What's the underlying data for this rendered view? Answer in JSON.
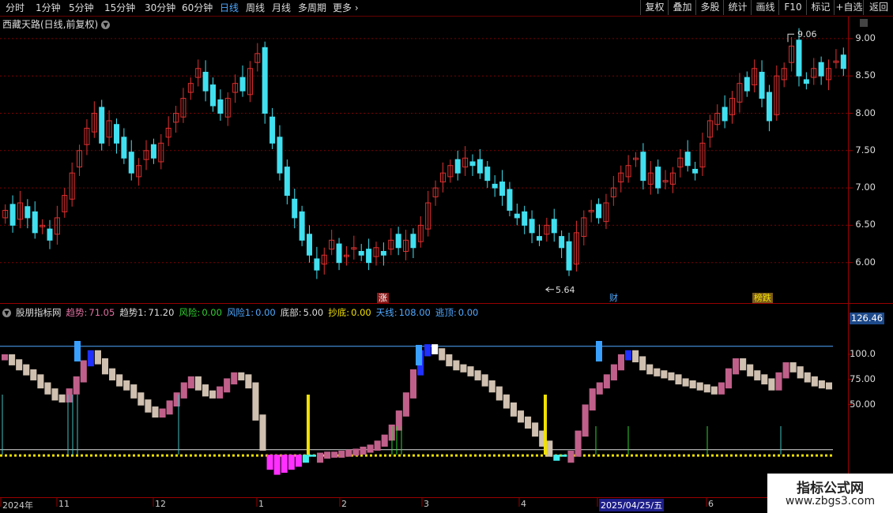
{
  "toolbar": {
    "periods": [
      "分时",
      "1分钟",
      "5分钟",
      "15分钟",
      "30分钟",
      "60分钟",
      "日线",
      "周线",
      "月线",
      "多周期",
      "更多"
    ],
    "active_period": "日线",
    "right_buttons": [
      "复权",
      "叠加",
      "多股",
      "统计",
      "画线",
      "F10",
      "标记",
      "+自选",
      "返回"
    ]
  },
  "main_chart": {
    "title": "西藏天路(日线,前复权)",
    "price_axis": [
      "9.00",
      "8.50",
      "8.00",
      "7.50",
      "7.00",
      "6.50",
      "6.00"
    ],
    "high_marker": "9.06",
    "low_marker": "5.64",
    "events": [
      "涨",
      "财",
      "榜跌"
    ]
  },
  "indicator": {
    "name": "股朋指标网",
    "fields": [
      {
        "label": "趋势:",
        "value": "71.05",
        "color": "#e070a0"
      },
      {
        "label": "趋势1:",
        "value": "71.20",
        "color": "#dddddd"
      },
      {
        "label": "风险:",
        "value": "0.00",
        "color": "#30d030"
      },
      {
        "label": "风险1:",
        "value": "0.00",
        "color": "#4fa8ff"
      },
      {
        "label": "底部:",
        "value": "5.00",
        "color": "#dddddd"
      },
      {
        "label": "抄底:",
        "value": "0.00",
        "color": "#f0e000"
      },
      {
        "label": "天线:",
        "value": "108.00",
        "color": "#4fa8ff"
      },
      {
        "label": "逃顶:",
        "value": "0.00",
        "color": "#4fa8ff"
      }
    ],
    "axis": [
      "100.0",
      "75.00",
      "50.00"
    ],
    "current_value": "126.46"
  },
  "date_axis": {
    "labels": [
      "2024年",
      "11",
      "12",
      "1",
      "2",
      "3",
      "4",
      "2025/04/25/五",
      "6"
    ]
  },
  "watermark": {
    "title": "指标公式网",
    "url": "www.zbgs3.com"
  },
  "chart_data": {
    "type": "candlestick",
    "ylim": [
      5.5,
      9.2
    ],
    "close_prices": [
      6.7,
      6.5,
      6.8,
      6.6,
      6.4,
      6.5,
      6.3,
      6.6,
      6.9,
      7.2,
      7.5,
      7.8,
      8.0,
      7.6,
      7.9,
      7.6,
      7.4,
      7.2,
      7.3,
      7.5,
      7.4,
      7.6,
      7.8,
      8.0,
      8.2,
      8.4,
      8.6,
      8.3,
      8.1,
      8.0,
      8.2,
      8.4,
      8.3,
      8.6,
      8.8,
      8.0,
      7.6,
      7.2,
      6.9,
      6.6,
      6.3,
      6.1,
      5.9,
      6.1,
      6.3,
      6.0,
      6.1,
      6.2,
      6.1,
      6.0,
      6.2,
      6.1,
      6.3,
      6.2,
      6.3,
      6.2,
      6.5,
      6.8,
      7.0,
      7.2,
      7.3,
      7.2,
      7.4,
      7.3,
      7.2,
      7.1,
      7.0,
      6.9,
      6.7,
      6.6,
      6.5,
      6.4,
      6.3,
      6.5,
      6.4,
      6.2,
      5.9,
      6.4,
      6.6,
      6.7,
      6.6,
      6.8,
      7.0,
      7.2,
      7.3,
      7.4,
      7.1,
      7.2,
      7.0,
      7.1,
      7.2,
      7.4,
      7.3,
      7.2,
      7.6,
      7.9,
      8.0,
      7.9,
      8.2,
      8.4,
      8.3,
      8.6,
      8.2,
      7.9,
      8.5,
      8.6,
      8.9,
      8.5,
      8.4,
      8.6,
      8.5,
      8.6,
      8.7,
      8.6
    ],
    "trend_values": [
      100,
      95,
      90,
      85,
      80,
      72,
      66,
      60,
      58,
      66,
      78,
      94,
      104,
      96,
      86,
      80,
      74,
      70,
      62,
      55,
      48,
      43,
      46,
      54,
      62,
      72,
      78,
      70,
      64,
      62,
      68,
      76,
      82,
      80,
      72,
      40,
      10,
      -15,
      -20,
      -18,
      -15,
      -12,
      -8,
      -2,
      2,
      3,
      3,
      4,
      5,
      6,
      8,
      10,
      14,
      20,
      30,
      44,
      62,
      85,
      104,
      110,
      106,
      100,
      94,
      90,
      88,
      84,
      80,
      74,
      68,
      60,
      52,
      44,
      38,
      32,
      24,
      14,
      4,
      -6,
      -2,
      4,
      24,
      50,
      66,
      72,
      80,
      90,
      100,
      104,
      98,
      90,
      86,
      84,
      82,
      80,
      76,
      74,
      72,
      70,
      68,
      66,
      72,
      86,
      96,
      90,
      84,
      80,
      76,
      70,
      82,
      92,
      88,
      82,
      78,
      74,
      72,
      71
    ]
  }
}
